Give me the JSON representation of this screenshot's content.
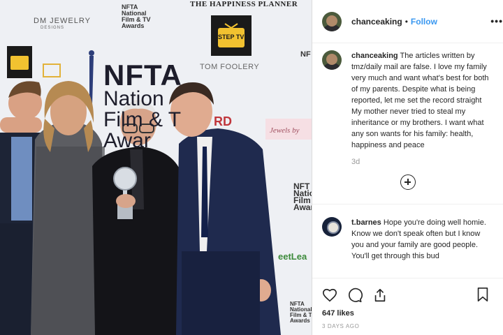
{
  "photo": {
    "wall_text": {
      "happiness_planner": "THE HAPPINESS PLANNER",
      "dm_jewelry": "DM JEWELRY",
      "dm_jewelry_sub": "DESIGNS",
      "nfta_small": "NFTA\nNational\nFilm & TV\nAwards",
      "step_tv": "STEP TV",
      "nfta_big": "NFTA",
      "national": "Nation\nFilm & T\nAwar",
      "tom_foolery": "TOM FOOLERY",
      "jewels": "Jewels by",
      "rd": "RD",
      "nfta_right": "NFT\nNation\nFilm &\nAwar",
      "nfta_right2": "NFTA\nNational\nFilm & TV\nAwards",
      "nfta_top_right": "NF",
      "sweetleaf": "eetLea"
    }
  },
  "post": {
    "header": {
      "username": "chanceaking",
      "separator": "•",
      "follow_label": "Follow",
      "more_label": "•••"
    },
    "comments": [
      {
        "username": "chanceaking",
        "text": "The articles written by tmz/daily mail are false. I love my family very much and want what's best for both of my parents. Despite what is being reported, let me set the record straight My mother never tried to steal my inheritance or my brothers. I want what any son wants for his family: health, happiness and peace",
        "time": "3d"
      },
      {
        "username": "t.barnes",
        "text": "Hope you're doing well homie. Know we don't speak often but I know you and your family are good people. You'll get through this bud"
      }
    ],
    "likes": "647 likes",
    "date": "3 DAYS AGO"
  },
  "colors": {
    "accent": "#3897f0",
    "text": "#262626",
    "muted": "#999999",
    "border": "#dbdbdb"
  },
  "icons": [
    "heart-icon",
    "comment-icon",
    "share-icon",
    "bookmark-icon",
    "plus-circle-icon"
  ]
}
